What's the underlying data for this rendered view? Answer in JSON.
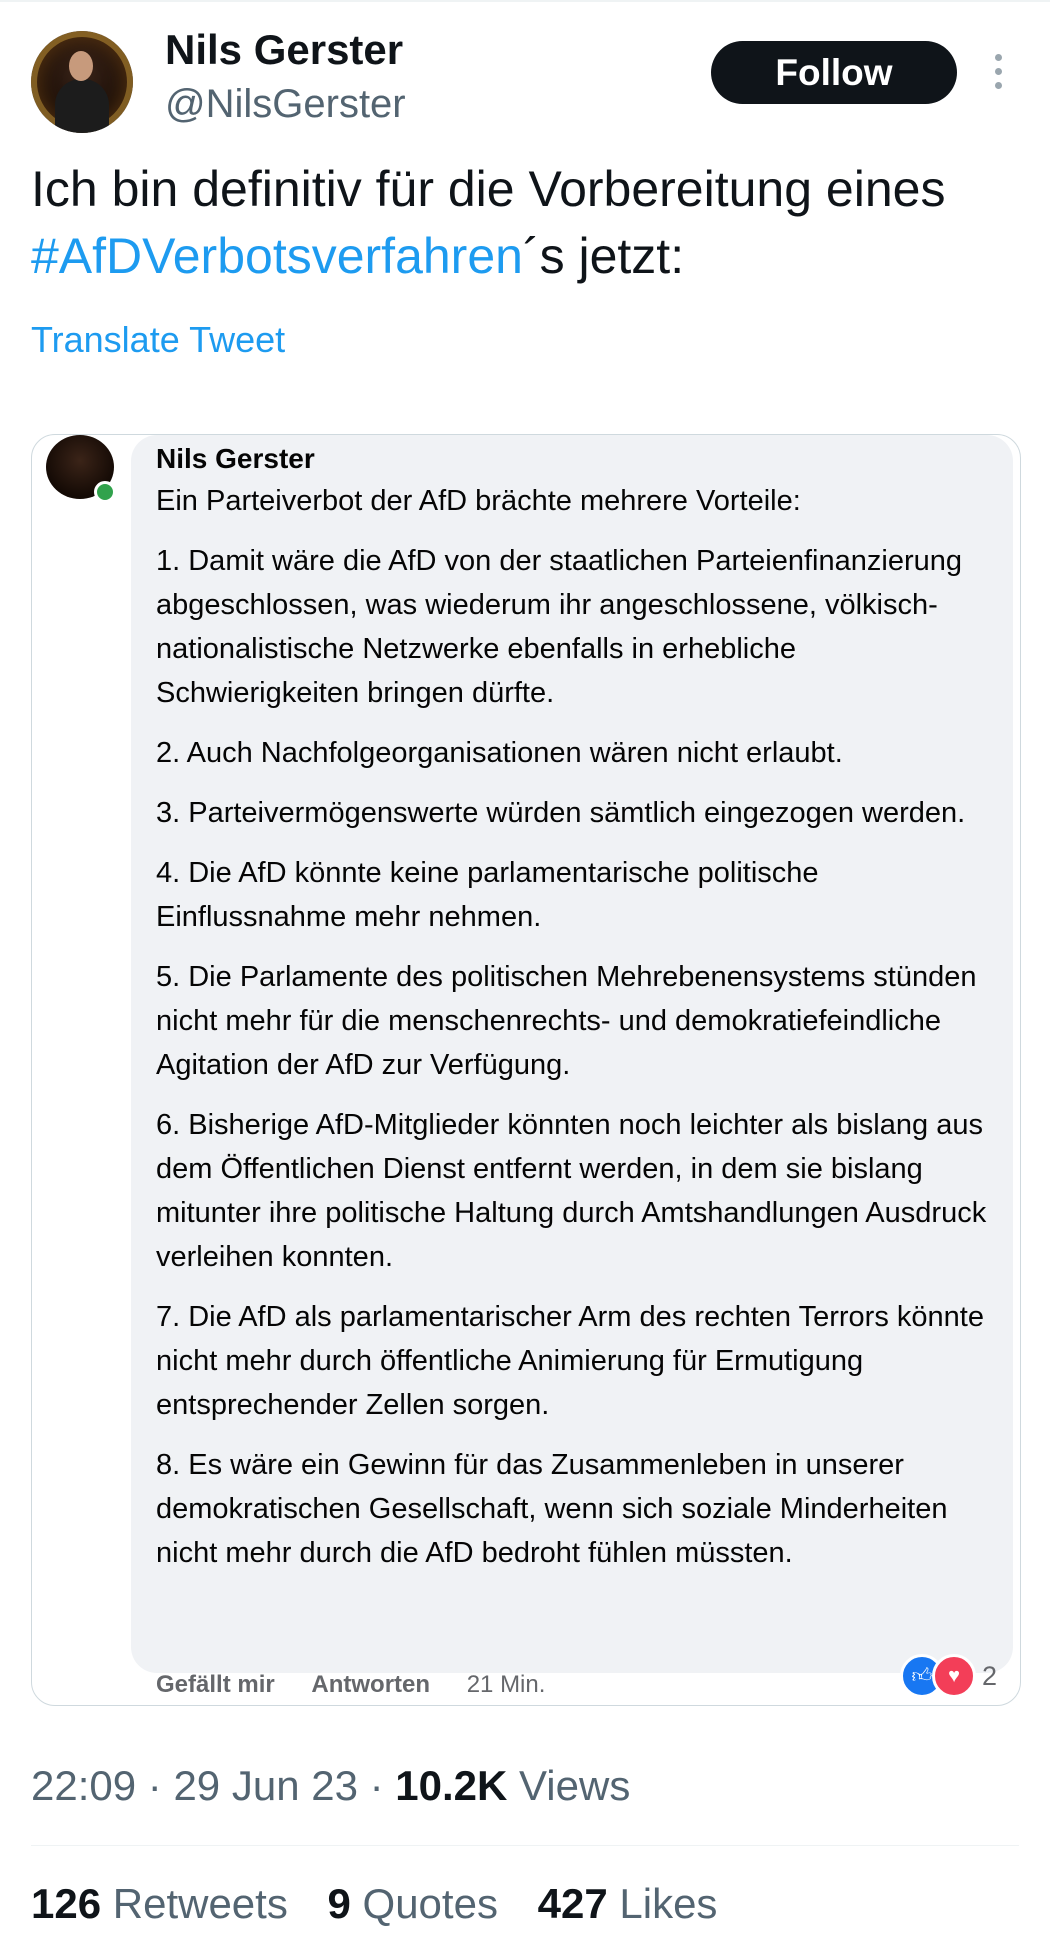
{
  "author": {
    "name": "Nils Gerster",
    "handle": "@NilsGerster"
  },
  "follow_label": "Follow",
  "tweet": {
    "text_before": "Ich bin definitiv für die Vorbereitung eines ",
    "hashtag": "#AfDVerbotsverfahren",
    "text_after": "´s jetzt:"
  },
  "translate_label": "Translate Tweet",
  "embedded_comment": {
    "name": "Nils Gerster",
    "paragraphs": [
      "Ein Parteiverbot der AfD brächte mehrere Vorteile:",
      "1. Damit wäre die AfD von der staatlichen Parteienfinanzierung abgeschlossen, was wiederum ihr angeschlossene, völkisch-nationalistische Netzwerke ebenfalls in erhebliche Schwierigkeiten bringen dürfte.",
      "2. Auch Nachfolgeorganisationen wären nicht erlaubt.",
      "3. Parteivermögenswerte würden sämtlich eingezogen werden.",
      "4. Die AfD könnte keine parlamentarische politische Einflussnahme mehr nehmen.",
      "5. Die Parlamente des politischen Mehrebenensystems stünden nicht mehr für die menschenrechts- und demokratiefeindliche Agitation der AfD zur Verfügung.",
      "6. Bisherige AfD-Mitglieder könnten noch leichter als bislang aus dem Öffentlichen Dienst entfernt werden, in dem sie bislang mitunter ihre politische Haltung durch Amtshandlungen Ausdruck verleihen konnten.",
      "7. Die AfD als parlamentarischer Arm des rechten Terrors könnte nicht mehr durch öffentliche Animierung für Ermutigung entsprechender Zellen sorgen.",
      "8. Es wäre ein Gewinn für das Zusammenleben in unserer demokratischen Gesellschaft, wenn sich soziale Minderheiten nicht mehr durch die AfD bedroht fühlen müssten."
    ],
    "reaction_count": "2",
    "like_label": "Gefällt mir",
    "reply_label": "Antworten",
    "time": "21 Min."
  },
  "meta": {
    "time": "22:09",
    "date": "29 Jun 23",
    "views_count": "10.2K",
    "views_label": "Views",
    "sep": "·"
  },
  "stats": {
    "retweets_count": "126",
    "retweets_label": "Retweets",
    "quotes_count": "9",
    "quotes_label": "Quotes",
    "likes_count": "427",
    "likes_label": "Likes"
  }
}
